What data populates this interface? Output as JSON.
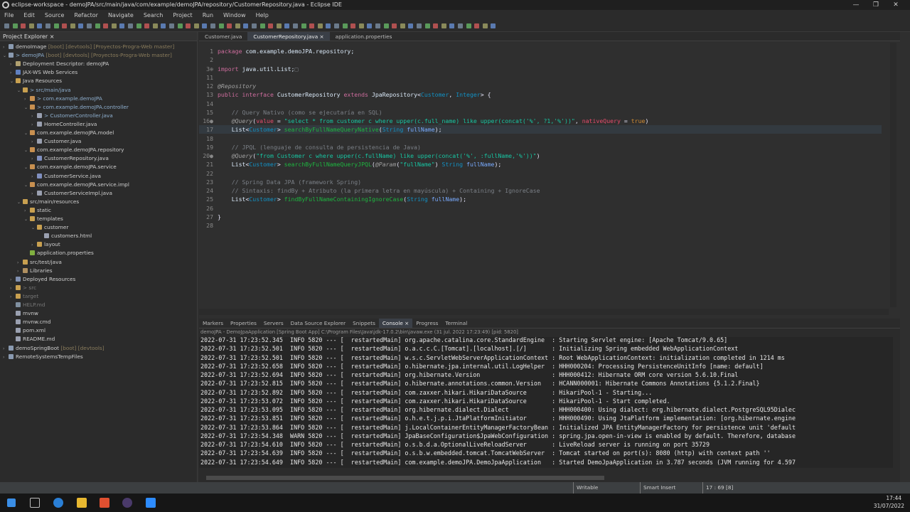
{
  "title": "eclipse-workspace - demoJPA/src/main/java/com/example/demoJPA/repository/CustomerRepository.java - Eclipse IDE",
  "menu": [
    "File",
    "Edit",
    "Source",
    "Refactor",
    "Navigate",
    "Search",
    "Project",
    "Run",
    "Window",
    "Help"
  ],
  "explorer": {
    "title": "Project Explorer ×",
    "items": [
      {
        "d": 0,
        "t": ">",
        "label": "demoImage",
        "dec": " [boot] [devtools] [Proyectos-Progra-Web master]",
        "c": "#8a9ab0"
      },
      {
        "d": 0,
        "t": "v",
        "label": "> demoJPA",
        "dec": " [boot] [devtools] [Proyectos-Progra-Web master]",
        "c": "#8a9ab0",
        "blue": true
      },
      {
        "d": 1,
        "t": ">",
        "label": "Deployment Descriptor: demoJPA",
        "c": "#b0a070"
      },
      {
        "d": 1,
        "t": ">",
        "label": "JAX-WS Web Services",
        "c": "#6080c0"
      },
      {
        "d": 1,
        "t": "v",
        "label": "Java Resources",
        "c": "#c8a050"
      },
      {
        "d": 2,
        "t": "v",
        "label": "> src/main/java",
        "c": "#c8a050",
        "blue": true
      },
      {
        "d": 3,
        "t": ">",
        "label": "> com.example.demoJPA",
        "c": "#c89050",
        "blue": true
      },
      {
        "d": 3,
        "t": "v",
        "label": "> com.example.demoJPA.controller",
        "c": "#c89050",
        "blue": true
      },
      {
        "d": 4,
        "t": ">",
        "label": "> CustomerController.java",
        "c": "#9aa0b0",
        "blue": true
      },
      {
        "d": 4,
        "t": ">",
        "label": "HomeController.java",
        "c": "#9aa0b0"
      },
      {
        "d": 3,
        "t": "v",
        "label": "com.example.demoJPA.model",
        "c": "#c89050"
      },
      {
        "d": 4,
        "t": ">",
        "label": "Customer.java",
        "c": "#9aa0b0"
      },
      {
        "d": 3,
        "t": "v",
        "label": "com.example.demoJPA.repository",
        "c": "#c89050"
      },
      {
        "d": 4,
        "t": ">",
        "label": "CustomerRepository.java",
        "c": "#8090c0"
      },
      {
        "d": 3,
        "t": "v",
        "label": "com.example.demoJPA.service",
        "c": "#c89050"
      },
      {
        "d": 4,
        "t": ">",
        "label": "CustomerService.java",
        "c": "#8090c0"
      },
      {
        "d": 3,
        "t": "v",
        "label": "com.example.demoJPA.service.impl",
        "c": "#c89050"
      },
      {
        "d": 4,
        "t": ">",
        "label": "CustomerServiceImpl.java",
        "c": "#9aa0b0"
      },
      {
        "d": 2,
        "t": "v",
        "label": "src/main/resources",
        "c": "#c8a050"
      },
      {
        "d": 3,
        "t": ">",
        "label": "static",
        "c": "#c8a050"
      },
      {
        "d": 3,
        "t": "v",
        "label": "templates",
        "c": "#c8a050"
      },
      {
        "d": 4,
        "t": "v",
        "label": "customer",
        "c": "#c8a050"
      },
      {
        "d": 5,
        "t": "",
        "label": "customers.html",
        "c": "#9aa0b0"
      },
      {
        "d": 4,
        "t": ">",
        "label": "layout",
        "c": "#c8a050"
      },
      {
        "d": 3,
        "t": "",
        "label": "application.properties",
        "c": "#80b040"
      },
      {
        "d": 2,
        "t": ">",
        "label": "src/test/java",
        "c": "#c8a050"
      },
      {
        "d": 2,
        "t": ">",
        "label": "Libraries",
        "c": "#b09060"
      },
      {
        "d": 1,
        "t": ">",
        "label": "Deployed Resources",
        "c": "#8090b0"
      },
      {
        "d": 1,
        "t": ">",
        "label": "> src",
        "c": "#c8a050",
        "dim": true
      },
      {
        "d": 1,
        "t": ">",
        "label": "target",
        "c": "#c8a050",
        "dim": true
      },
      {
        "d": 1,
        "t": "",
        "label": "HELP.md",
        "c": "#8090a0",
        "dim": true
      },
      {
        "d": 1,
        "t": "",
        "label": "mvnw",
        "c": "#9aa0b0"
      },
      {
        "d": 1,
        "t": "",
        "label": "mvnw.cmd",
        "c": "#9aa0b0"
      },
      {
        "d": 1,
        "t": "",
        "label": "pom.xml",
        "c": "#9aa0b0"
      },
      {
        "d": 1,
        "t": "",
        "label": "README.md",
        "c": "#9aa0b0"
      },
      {
        "d": 0,
        "t": ">",
        "label": "demoSpringBoot",
        "dec": " [boot] [devtools]",
        "c": "#8a9ab0"
      },
      {
        "d": 0,
        "t": ">",
        "label": "RemoteSystemsTempFiles",
        "c": "#8a9ab0"
      }
    ]
  },
  "editor": {
    "tabs": [
      "Customer.java",
      "CustomerRepository.java ×",
      "application.properties"
    ],
    "active_tab": 1,
    "lines": [
      {
        "n": "1",
        "tokens": [
          [
            "package ",
            "kw"
          ],
          [
            "com.example.demoJPA.repository;",
            "pk"
          ]
        ]
      },
      {
        "n": "2",
        "tokens": []
      },
      {
        "n": "3⊕",
        "tokens": [
          [
            "import ",
            "kw"
          ],
          [
            "java.util.List;",
            "pk"
          ],
          [
            "□",
            "cm"
          ]
        ]
      },
      {
        "n": "11",
        "tokens": []
      },
      {
        "n": "12",
        "tokens": [
          [
            "@Repository",
            "an"
          ]
        ]
      },
      {
        "n": "13",
        "tokens": [
          [
            "public interface ",
            "kw"
          ],
          [
            "CustomerRepository ",
            "id"
          ],
          [
            "extends ",
            "kw"
          ],
          [
            "JpaRepository",
            "id"
          ],
          [
            "<",
            "pn"
          ],
          [
            "Customer",
            "ty"
          ],
          [
            ", ",
            "pn"
          ],
          [
            "Integer",
            "ty"
          ],
          [
            "> {",
            "pn"
          ]
        ]
      },
      {
        "n": "14",
        "tokens": []
      },
      {
        "n": "15",
        "tokens": [
          [
            "    // Query Nativo (como se ejecutaría en SQL)",
            "cm"
          ]
        ]
      },
      {
        "n": "16●",
        "tokens": [
          [
            "    @Query",
            "an"
          ],
          [
            "(",
            "pn"
          ],
          [
            "value",
            "red"
          ],
          [
            " = ",
            "pn"
          ],
          [
            "\"select * from customer c where upper(c.full_name) like upper(concat('%', ?1,'%'))\"",
            "st"
          ],
          [
            ", ",
            "pn"
          ],
          [
            "nativeQuery",
            "red"
          ],
          [
            " = ",
            "pn"
          ],
          [
            "true",
            "bool"
          ],
          [
            ")",
            "pn"
          ]
        ]
      },
      {
        "n": "17",
        "tokens": [
          [
            "    List",
            "id"
          ],
          [
            "<",
            "pn"
          ],
          [
            "Customer",
            "ty"
          ],
          [
            "> ",
            "pn"
          ],
          [
            "searchByFullNameQueryNative",
            "fn"
          ],
          [
            "(",
            "pn"
          ],
          [
            "String ",
            "ty"
          ],
          [
            "fullName",
            "var"
          ],
          [
            ");",
            "pn"
          ]
        ],
        "cur": true
      },
      {
        "n": "18",
        "tokens": []
      },
      {
        "n": "19",
        "tokens": [
          [
            "    // JPQL (lenguaje de consulta de persistencia de Java)",
            "cm"
          ]
        ]
      },
      {
        "n": "20●",
        "tokens": [
          [
            "    @Query",
            "an"
          ],
          [
            "(",
            "pn"
          ],
          [
            "\"from Customer c where upper(c.fullName) like upper(concat('%', :fullName,'%'))\"",
            "st"
          ],
          [
            ")",
            "pn"
          ]
        ]
      },
      {
        "n": "21",
        "tokens": [
          [
            "    List",
            "id"
          ],
          [
            "<",
            "pn"
          ],
          [
            "Customer",
            "ty"
          ],
          [
            "> ",
            "pn"
          ],
          [
            "searchByFullNameQueryJPQL",
            "fn"
          ],
          [
            "(",
            "pn"
          ],
          [
            "@Param",
            "an"
          ],
          [
            "(",
            "pn"
          ],
          [
            "\"fullName\"",
            "st"
          ],
          [
            ") ",
            "pn"
          ],
          [
            "String ",
            "ty"
          ],
          [
            "fullName",
            "var"
          ],
          [
            ");",
            "pn"
          ]
        ]
      },
      {
        "n": "22",
        "tokens": []
      },
      {
        "n": "23",
        "tokens": [
          [
            "    // Spring Data JPA (framework Spring)",
            "cm"
          ]
        ]
      },
      {
        "n": "24",
        "tokens": [
          [
            "    // Sintaxis: findBy + Atributo (la primera letra en mayúscula) + Containing + IgnoreCase",
            "cm"
          ]
        ]
      },
      {
        "n": "25",
        "tokens": [
          [
            "    List",
            "id"
          ],
          [
            "<",
            "pn"
          ],
          [
            "Customer",
            "ty"
          ],
          [
            "> ",
            "pn"
          ],
          [
            "findByFullNameContainingIgnoreCase",
            "fn"
          ],
          [
            "(",
            "pn"
          ],
          [
            "String ",
            "ty"
          ],
          [
            "fullName",
            "var"
          ],
          [
            ");",
            "pn"
          ]
        ]
      },
      {
        "n": "26",
        "tokens": []
      },
      {
        "n": "27",
        "tokens": [
          [
            "}",
            "pn"
          ]
        ]
      },
      {
        "n": "28",
        "tokens": []
      }
    ]
  },
  "bottom": {
    "tabs": [
      "Markers",
      "Properties",
      "Servers",
      "Data Source Explorer",
      "Snippets",
      "Console ×",
      "Progress",
      "Terminal"
    ],
    "active_tab": 5,
    "console_desc": "demoJPA - DemoJpaApplication [Spring Boot App] C:\\Program Files\\Java\\jdk-17.0.2\\bin\\javaw.exe  (31 jul. 2022 17:23:49) [pid: 5820]",
    "console": [
      "2022-07-31 17:23:52.345  INFO 5820 --- [  restartedMain] org.apache.catalina.core.StandardEngine  : Starting Servlet engine: [Apache Tomcat/9.0.65]",
      "2022-07-31 17:23:52.501  INFO 5820 --- [  restartedMain] o.a.c.c.C.[Tomcat].[localhost].[/]       : Initializing Spring embedded WebApplicationContext",
      "2022-07-31 17:23:52.501  INFO 5820 --- [  restartedMain] w.s.c.ServletWebServerApplicationContext : Root WebApplicationContext: initialization completed in 1214 ms",
      "2022-07-31 17:23:52.658  INFO 5820 --- [  restartedMain] o.hibernate.jpa.internal.util.LogHelper  : HHH000204: Processing PersistenceUnitInfo [name: default]",
      "2022-07-31 17:23:52.694  INFO 5820 --- [  restartedMain] org.hibernate.Version                    : HHH000412: Hibernate ORM core version 5.6.10.Final",
      "2022-07-31 17:23:52.815  INFO 5820 --- [  restartedMain] o.hibernate.annotations.common.Version   : HCANN000001: Hibernate Commons Annotations {5.1.2.Final}",
      "2022-07-31 17:23:52.892  INFO 5820 --- [  restartedMain] com.zaxxer.hikari.HikariDataSource       : HikariPool-1 - Starting...",
      "2022-07-31 17:23:53.072  INFO 5820 --- [  restartedMain] com.zaxxer.hikari.HikariDataSource       : HikariPool-1 - Start completed.",
      "2022-07-31 17:23:53.095  INFO 5820 --- [  restartedMain] org.hibernate.dialect.Dialect            : HHH000400: Using dialect: org.hibernate.dialect.PostgreSQL95Dialec",
      "2022-07-31 17:23:53.851  INFO 5820 --- [  restartedMain] o.h.e.t.j.p.i.JtaPlatformInitiator       : HHH000490: Using JtaPlatform implementation: [org.hibernate.engine",
      "2022-07-31 17:23:53.864  INFO 5820 --- [  restartedMain] j.LocalContainerEntityManagerFactoryBean : Initialized JPA EntityManagerFactory for persistence unit 'default",
      "2022-07-31 17:23:54.348  WARN 5820 --- [  restartedMain] JpaBaseConfiguration$JpaWebConfiguration : spring.jpa.open-in-view is enabled by default. Therefore, database",
      "2022-07-31 17:23:54.610  INFO 5820 --- [  restartedMain] o.s.b.d.a.OptionalLiveReloadServer       : LiveReload server is running on port 35729",
      "2022-07-31 17:23:54.639  INFO 5820 --- [  restartedMain] o.s.b.w.embedded.tomcat.TomcatWebServer  : Tomcat started on port(s): 8080 (http) with context path ''",
      "2022-07-31 17:23:54.649  INFO 5820 --- [  restartedMain] com.example.demoJPA.DemoJpaApplication   : Started DemoJpaApplication in 3.787 seconds (JVM running for 4.597"
    ]
  },
  "status": {
    "writable": "Writable",
    "insert": "Smart Insert",
    "position": "17 : 69 [8]"
  },
  "taskbar": {
    "time": "17:44",
    "date": "31/07/2022"
  }
}
